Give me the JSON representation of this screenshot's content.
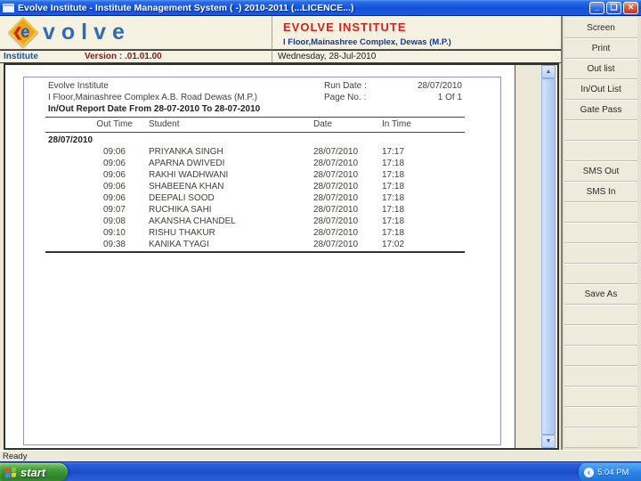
{
  "window": {
    "title": "Evolve Institute - Institute Management System ( -) 2010-2011 (...LICENCE...)",
    "controls": {
      "minimize": "_",
      "restore": "❏",
      "close": "✕"
    }
  },
  "header": {
    "logo_chevron": "❮",
    "logo_letter": "e",
    "logo_word": "volve",
    "institute_name": "EVOLVE INSTITUTE",
    "institute_address": "I Floor,Mainashree Complex, Dewas (M.P.)",
    "module": "Institute",
    "version": "Version : .01.01.00",
    "date": "Wednesday, 28-Jul-2010"
  },
  "report": {
    "org_name": "Evolve Institute",
    "org_address": "I Floor,Mainashree Complex A.B. Road Dewas (M.P.)",
    "run_date_label": "Run Date :",
    "run_date": "28/07/2010",
    "page_no_label": "Page No. :",
    "page_no": "1 Of 1",
    "title": "In/Out Report Date From 28-07-2010 To 28-07-2010",
    "columns": [
      "Out Time",
      "Student",
      "Date",
      "In Time"
    ],
    "group_date": "28/07/2010",
    "rows": [
      {
        "out": "09:06",
        "name": "PRIYANKA SINGH",
        "date": "28/07/2010",
        "in_time": "17:17"
      },
      {
        "out": "09:06",
        "name": "APARNA  DWIVEDI",
        "date": "28/07/2010",
        "in_time": "17:18"
      },
      {
        "out": "09:06",
        "name": "RAKHI WADHWANI",
        "date": "28/07/2010",
        "in_time": "17:18"
      },
      {
        "out": "09:06",
        "name": "SHABEENA KHAN",
        "date": "28/07/2010",
        "in_time": "17:18"
      },
      {
        "out": "09:06",
        "name": "DEEPALI  SOOD",
        "date": "28/07/2010",
        "in_time": "17:18"
      },
      {
        "out": "09:07",
        "name": "RUCHIKA  SAHI",
        "date": "28/07/2010",
        "in_time": "17:18"
      },
      {
        "out": "09:08",
        "name": "AKANSHA CHANDEL",
        "date": "28/07/2010",
        "in_time": "17:18"
      },
      {
        "out": "09:10",
        "name": "RISHU  THAKUR",
        "date": "28/07/2010",
        "in_time": "17:18"
      },
      {
        "out": "09:38",
        "name": "KANIKA  TYAGI",
        "date": "28/07/2010",
        "in_time": "17:02"
      }
    ]
  },
  "scrollbar": {
    "up_arrow": "▲",
    "down_arrow": "▼"
  },
  "sidebar": {
    "buttons": [
      {
        "label": "Screen"
      },
      {
        "label": "Print"
      },
      {
        "label": "Out list"
      },
      {
        "label": "In/Out List"
      },
      {
        "label": "Gate Pass"
      },
      {
        "label": ""
      },
      {
        "label": ""
      },
      {
        "label": "SMS Out"
      },
      {
        "label": "SMS In"
      },
      {
        "label": ""
      },
      {
        "label": ""
      },
      {
        "label": ""
      },
      {
        "label": ""
      },
      {
        "label": "Save As"
      },
      {
        "label": ""
      },
      {
        "label": ""
      },
      {
        "label": ""
      },
      {
        "label": ""
      },
      {
        "label": ""
      },
      {
        "label": ""
      },
      {
        "label": ""
      }
    ]
  },
  "statusbar": {
    "text": "Ready"
  },
  "taskbar": {
    "start_label": "start",
    "clock": "5:04 PM",
    "tray_chevron": "‹"
  },
  "colors": {
    "titlebar_blue": "#1350d6",
    "header_cream": "#f5f2e1",
    "accent_red": "#d42020",
    "address_blue": "#16389c",
    "version_maroon": "#8b1a1a",
    "logo_blue": "#2e6cb4",
    "logo_orange": "#f0a41e",
    "page_border_purple": "#9393c6",
    "button_face": "#eeebdc",
    "taskbar_blue": "#1c4cc6",
    "start_green": "#3f9a38"
  }
}
